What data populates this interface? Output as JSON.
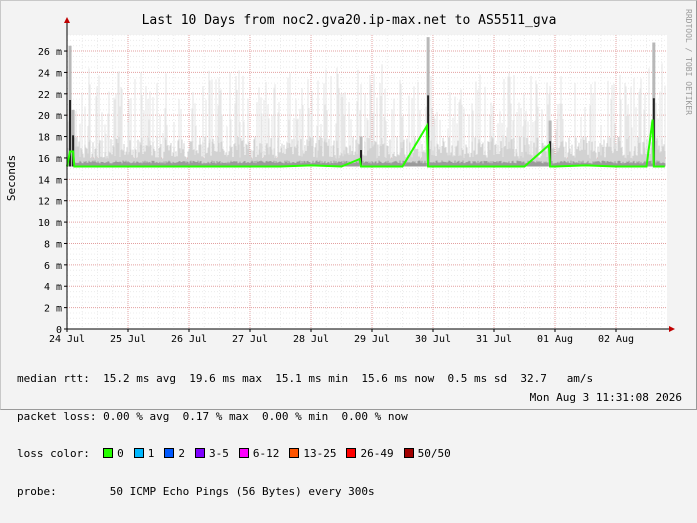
{
  "chart_data": {
    "type": "area",
    "title": "Last 10 Days from noc2.gva20.ip-max.net to AS5511_gva",
    "ylabel": "Seconds",
    "watermark": "RRDTOOL / TOBI OETIKER",
    "ylim": [
      0,
      27.5
    ],
    "y_ticks": [
      0,
      2,
      4,
      6,
      8,
      10,
      12,
      14,
      16,
      18,
      20,
      22,
      24,
      26
    ],
    "y_tick_labels": [
      "0",
      "2 m",
      "4 m",
      "6 m",
      "8 m",
      "10 m",
      "12 m",
      "14 m",
      "16 m",
      "18 m",
      "20 m",
      "22 m",
      "24 m",
      "26 m"
    ],
    "x_days": [
      0,
      1,
      2,
      3,
      4,
      5,
      6,
      7,
      8,
      9,
      10
    ],
    "x_ticks": [
      0,
      1,
      2,
      3,
      4,
      5,
      6,
      7,
      8
    ],
    "x_tick_labels": [
      "24 Jul",
      "25 Jul",
      "26 Jul",
      "27 Jul",
      "28 Jul",
      "29 Jul",
      "30 Jul",
      "31 Jul",
      "01 Aug",
      "02 Aug"
    ],
    "xlim_days": [
      0,
      9.8
    ],
    "median_day": [
      0.0,
      0.05,
      0.1,
      0.12,
      0.5,
      1.0,
      1.5,
      2.0,
      2.5,
      3.0,
      3.5,
      4.0,
      4.5,
      4.8,
      4.82,
      5.0,
      5.5,
      5.9,
      5.92,
      6.0,
      6.5,
      7.0,
      7.5,
      7.9,
      7.92,
      8.0,
      8.5,
      9.0,
      9.5,
      9.6,
      9.62,
      9.8
    ],
    "median_ms": [
      15.2,
      16.6,
      16.6,
      15.2,
      15.2,
      15.2,
      15.2,
      15.2,
      15.2,
      15.2,
      15.2,
      15.3,
      15.2,
      15.9,
      15.2,
      15.2,
      15.2,
      19.0,
      15.2,
      15.2,
      15.2,
      15.2,
      15.2,
      17.2,
      15.2,
      15.2,
      15.3,
      15.2,
      15.2,
      19.6,
      15.2,
      15.2
    ],
    "spikes": [
      {
        "day": 0.05,
        "max": 26.5
      },
      {
        "day": 0.1,
        "max": 20.5
      },
      {
        "day": 5.92,
        "max": 27.3
      },
      {
        "day": 9.62,
        "max": 26.8
      },
      {
        "day": 4.82,
        "max": 18.0
      },
      {
        "day": 7.92,
        "max": 19.5
      }
    ],
    "legend_colors": {
      "0": "#26ff00",
      "1": "#00b8ff",
      "2": "#0059ff",
      "3-5": "#7e00ff",
      "6-12": "#ff00ff",
      "13-25": "#ff5500",
      "26-49": "#ff0000",
      "50/50": "#a10000"
    }
  },
  "stats": {
    "median_rtt_label": "median rtt:",
    "median_rtt_values": "15.2 ms avg  19.6 ms max  15.1 ms min  15.6 ms now  0.5 ms sd  32.7   am/s",
    "packet_loss_label": "packet loss:",
    "packet_loss_values": "0.00 % avg  0.17 % max  0.00 % min  0.00 % now",
    "loss_color_label": "loss color:",
    "loss_color_items": [
      "0",
      "1",
      "2",
      "3-5",
      "6-12",
      "13-25",
      "26-49",
      "50/50"
    ],
    "probe_label": "probe:",
    "probe_value": "50 ICMP Echo Pings (56 Bytes) every 300s"
  },
  "date_text": "Mon Aug  3 11:31:08 2026"
}
